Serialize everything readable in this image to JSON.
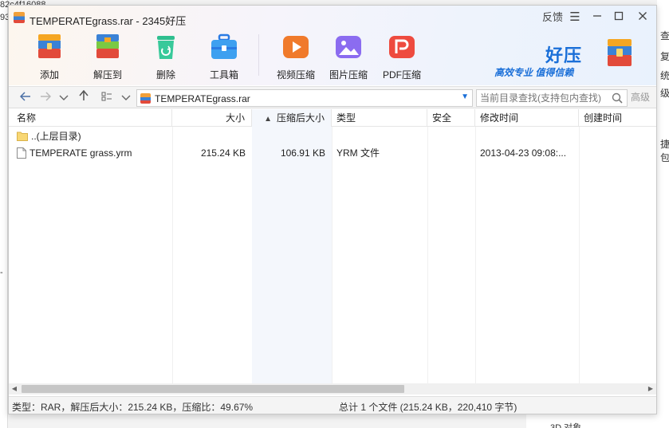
{
  "background": {
    "left_lines": [
      "82c4f16088",
      "93",
      "-"
    ],
    "right_lines": [
      "查",
      "复",
      "统",
      "级",
      "捷包"
    ],
    "bottom_text": "3D 对象"
  },
  "window": {
    "title": "TEMPERATEgrass.rar - 2345好压",
    "feedback_label": "反馈",
    "menu_icon": "menu-icon",
    "minimize_icon": "minimize-icon",
    "maximize_icon": "maximize-icon",
    "close_icon": "close-icon"
  },
  "toolbar": {
    "items": [
      {
        "label": "添加",
        "icon": "add-archive-icon"
      },
      {
        "label": "解压到",
        "icon": "extract-icon"
      },
      {
        "label": "删除",
        "icon": "delete-icon"
      },
      {
        "label": "工具箱",
        "icon": "toolbox-icon"
      },
      {
        "label": "视频压缩",
        "icon": "video-compress-icon"
      },
      {
        "label": "图片压缩",
        "icon": "image-compress-icon"
      },
      {
        "label": "PDF压缩",
        "icon": "pdf-compress-icon"
      }
    ],
    "brand_name": "好压",
    "brand_slogan": "高效专业 值得信赖",
    "accent_color": "#1a6fd8"
  },
  "addressbar": {
    "path": "TEMPERATEgrass.rar",
    "search_placeholder": "当前目录查找(支持包内查找)",
    "advanced_label": "高级"
  },
  "filelist": {
    "columns": {
      "name": "名称",
      "size": "大小",
      "compressed": "压缩后大小",
      "type": "类型",
      "security": "安全",
      "modified": "修改时间",
      "created": "创建时间"
    },
    "sorted_column": "compressed",
    "rows": [
      {
        "name": "..(上层目录)",
        "icon": "folder-icon",
        "size": "",
        "compressed": "",
        "type": "",
        "modified": ""
      },
      {
        "name": "TEMPERATE grass.yrm",
        "icon": "file-icon",
        "size": "215.24 KB",
        "compressed": "106.91 KB",
        "type": "YRM 文件",
        "modified": "2013-04-23 09:08:..."
      }
    ]
  },
  "statusbar": {
    "left": "类型：RAR，解压后大小：215.24 KB，压缩比：49.67%",
    "right": "总计 1 个文件 (215.24 KB，220,410 字节)"
  }
}
